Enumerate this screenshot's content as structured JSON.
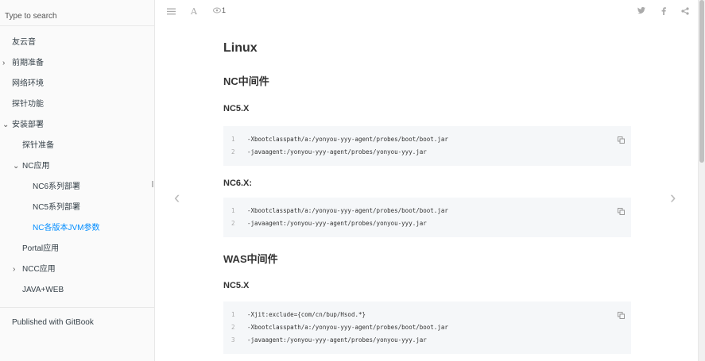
{
  "search": {
    "placeholder": "Type to search"
  },
  "sidebar": {
    "items": [
      {
        "label": "友云音"
      },
      {
        "label": "前期准备"
      },
      {
        "label": "网络环境"
      },
      {
        "label": "探针功能"
      },
      {
        "label": "安装部署"
      },
      {
        "label": "探针准备"
      },
      {
        "label": "NC应用"
      },
      {
        "label": "NC6系列部署"
      },
      {
        "label": "NC5系列部署"
      },
      {
        "label": "NC各版本JVM参数"
      },
      {
        "label": "Portal应用"
      },
      {
        "label": "NCC应用"
      },
      {
        "label": "JAVA+WEB"
      }
    ],
    "footer": "Published with GitBook"
  },
  "toolbar": {
    "view_count": "1",
    "icons": [
      "menu-icon",
      "font-icon",
      "eye-icon",
      "twitter-icon",
      "facebook-icon",
      "share-icon"
    ]
  },
  "content": {
    "title": "Linux",
    "sections": [
      {
        "heading": "NC中间件",
        "subsections": [
          {
            "heading": "NC5.X",
            "lines": [
              "-Xbootclasspath/a:/yonyou-yyy-agent/probes/boot/boot.jar",
              "-javaagent:/yonyou-yyy-agent/probes/yonyou-yyy.jar"
            ]
          },
          {
            "heading": "NC6.X:",
            "lines": [
              "-Xbootclasspath/a:/yonyou-yyy-agent/probes/boot/boot.jar",
              "-javaagent:/yonyou-yyy-agent/probes/yonyou-yyy.jar"
            ]
          }
        ]
      },
      {
        "heading": "WAS中间件",
        "subsections": [
          {
            "heading": "NC5.X",
            "lines": [
              "-Xjit:exclude={com/cn/bup/Hsod.*}",
              "-Xbootclasspath/a:/yonyou-yyy-agent/probes/boot/boot.jar",
              "-javaagent:/yonyou-yyy-agent/probes/yonyou-yyy.jar"
            ]
          }
        ]
      }
    ]
  },
  "colors": {
    "active": "#008cff",
    "sidebar_bg": "#fafafa",
    "code_bg": "#f5f7f9"
  }
}
